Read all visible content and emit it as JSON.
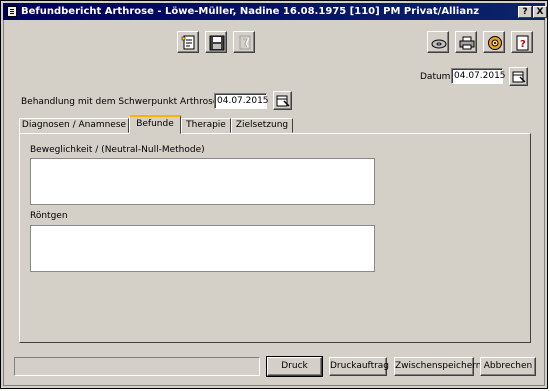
{
  "window": {
    "title": "Befundbericht Arthrose - Löwe-Müller, Nadine 16.08.1975 [110] PM Privat/Allianz",
    "help_label": "?",
    "close_label": "X"
  },
  "toolbar_left": [
    {
      "name": "new-document-icon"
    },
    {
      "name": "save-icon"
    },
    {
      "name": "disabled-document-icon"
    }
  ],
  "toolbar_right": [
    {
      "name": "cd-icon"
    },
    {
      "name": "printer-icon"
    },
    {
      "name": "settings-wheel-icon"
    },
    {
      "name": "help-document-icon"
    }
  ],
  "date": {
    "label": "Datum",
    "value": "04.07.2015"
  },
  "treatment": {
    "label": "Behandlung mit dem Schwerpunkt Arthrose am",
    "value": "04.07.2015"
  },
  "tabs": [
    {
      "label": "Diagnosen / Anamnese",
      "active": false
    },
    {
      "label": "Befunde",
      "active": true
    },
    {
      "label": "Therapie",
      "active": false
    },
    {
      "label": "Zielsetzung",
      "active": false
    }
  ],
  "findings": {
    "mobility_label": "Beweglichkeit / (Neutral-Null-Methode)",
    "mobility_value": "",
    "xray_label": "Röntgen",
    "xray_value": ""
  },
  "footer": {
    "status_text": "",
    "print": "Druck",
    "print_job": "Druckauftrag",
    "intermediate_save": "Zwischenspeichern",
    "cancel": "Abbrechen"
  },
  "colors": {
    "titlebar": "#0a246a",
    "dialog_bg": "#d4d0c8",
    "active_tab_accent": "#ffb000"
  }
}
